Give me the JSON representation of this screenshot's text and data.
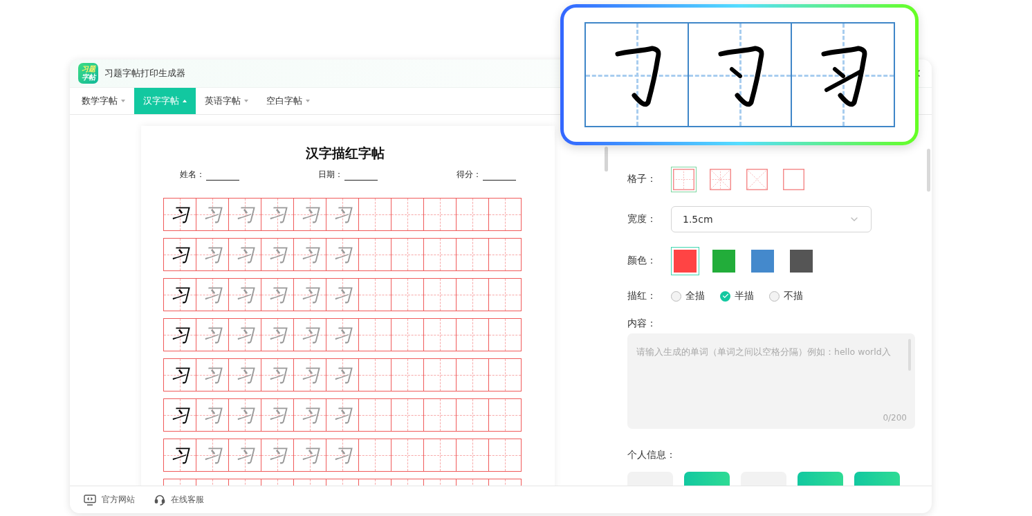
{
  "app": {
    "logo": [
      "习题",
      "字帖"
    ],
    "title": "习题字帖打印生成器"
  },
  "tabs": [
    {
      "label": "数学字帖",
      "selected": false
    },
    {
      "label": "汉字字帖",
      "selected": true
    },
    {
      "label": "英语字帖",
      "selected": false
    },
    {
      "label": "空白字帖",
      "selected": false
    }
  ],
  "worksheet": {
    "title": "汉字描红字帖",
    "fields": [
      "姓名：",
      "日期：",
      "得分："
    ],
    "rows": [
      {
        "model": "习",
        "traces": [
          "习",
          "习",
          "习",
          "习",
          "习"
        ]
      },
      {
        "model": "习",
        "traces": [
          "习",
          "习",
          "习",
          "习",
          "习"
        ]
      },
      {
        "model": "习",
        "traces": [
          "习",
          "习",
          "习",
          "习",
          "习"
        ]
      },
      {
        "model": "习",
        "traces": [
          "习",
          "习",
          "习",
          "习",
          "习"
        ]
      },
      {
        "model": "习",
        "traces": [
          "习",
          "习",
          "习",
          "习",
          "习"
        ]
      },
      {
        "model": "习",
        "traces": [
          "习",
          "习",
          "习",
          "习",
          "习"
        ]
      },
      {
        "model": "习",
        "traces": [
          "习",
          "习",
          "习",
          "习",
          "习"
        ]
      }
    ]
  },
  "settings": {
    "grid": {
      "label": "格子：",
      "options": [
        {
          "kind": "tian",
          "selected": true
        },
        {
          "kind": "mi",
          "selected": false
        },
        {
          "kind": "cross",
          "selected": false
        },
        {
          "kind": "plain",
          "selected": false
        }
      ]
    },
    "width": {
      "label": "宽度：",
      "value": "1.5cm"
    },
    "color": {
      "label": "颜色：",
      "options": [
        {
          "color": "#ff4444",
          "selected": true
        },
        {
          "color": "#22ad3a",
          "selected": false
        },
        {
          "color": "#4489cc",
          "selected": false
        },
        {
          "color": "#555555",
          "selected": false
        }
      ]
    },
    "trace": {
      "label": "描红：",
      "options": [
        {
          "label": "全描",
          "selected": false
        },
        {
          "label": "半描",
          "selected": true
        },
        {
          "label": "不描",
          "selected": false
        }
      ]
    },
    "content": {
      "label": "内容：",
      "placeholder": "请输入生成的单词（单词之间以空格分隔）例如：hello world入",
      "counter": "0/200"
    },
    "personal": {
      "label": "个人信息：",
      "chips": [
        {
          "selected": false
        },
        {
          "selected": true
        },
        {
          "selected": false
        },
        {
          "selected": true
        },
        {
          "selected": true
        }
      ]
    }
  },
  "footer": [
    {
      "kind": "website",
      "label": "官方网站"
    },
    {
      "kind": "support",
      "label": "在线客服"
    }
  ],
  "popup": {
    "steps": [
      {
        "kind": "hook"
      },
      {
        "kind": "dot"
      },
      {
        "kind": "rise"
      }
    ]
  }
}
